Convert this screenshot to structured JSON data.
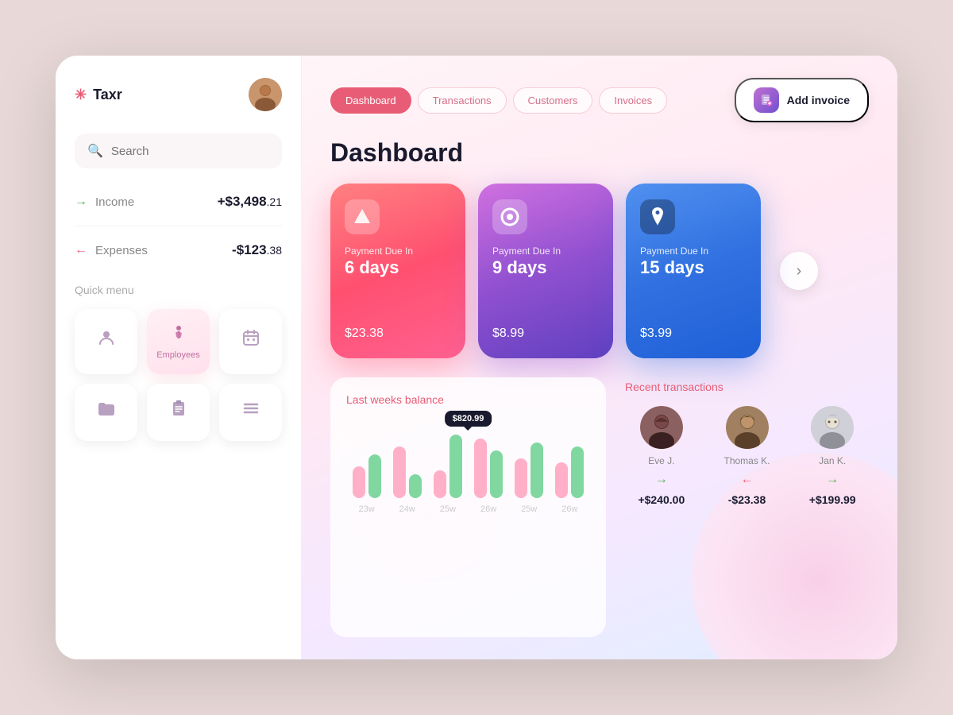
{
  "app": {
    "name": "Taxr",
    "logo_icon": "✳"
  },
  "nav": {
    "tabs": [
      {
        "id": "dashboard",
        "label": "Dashboard",
        "active": true
      },
      {
        "id": "transactions",
        "label": "Transactions",
        "active": false
      },
      {
        "id": "customers",
        "label": "Customers",
        "active": false
      },
      {
        "id": "invoices",
        "label": "Invoices",
        "active": false
      }
    ],
    "add_invoice_label": "Add invoice"
  },
  "sidebar": {
    "search_placeholder": "Search",
    "income": {
      "label": "Income",
      "value": "+$3,498",
      "cents": ".21"
    },
    "expenses": {
      "label": "Expenses",
      "value": "-$123",
      "cents": ".38"
    },
    "quick_menu": {
      "label": "Quick menu",
      "items": [
        {
          "id": "contacts",
          "icon": "👤",
          "label": "",
          "active": false
        },
        {
          "id": "employees",
          "icon": "🧍",
          "label": "Employees",
          "active": true
        },
        {
          "id": "calendar",
          "icon": "📅",
          "label": "",
          "active": false
        },
        {
          "id": "folder",
          "icon": "📁",
          "label": "",
          "active": false
        },
        {
          "id": "clipboard",
          "icon": "📋",
          "label": "",
          "active": false
        },
        {
          "id": "menu",
          "icon": "≡",
          "label": "",
          "active": false
        }
      ]
    }
  },
  "page_title": "Dashboard",
  "payment_cards": [
    {
      "id": "card1",
      "gradient": "red",
      "logo": "▲",
      "due_label": "Payment Due In",
      "due_days": "6 days",
      "amount": "$23",
      "cents": ".38"
    },
    {
      "id": "card2",
      "gradient": "purple",
      "logo": "⊙",
      "due_label": "Payment Due In",
      "due_days": "9 days",
      "amount": "$8",
      "cents": ".99"
    },
    {
      "id": "card3",
      "gradient": "blue",
      "logo": "",
      "due_label": "Payment Due In",
      "due_days": "15 days",
      "amount": "$3",
      "cents": ".99"
    }
  ],
  "balance": {
    "title": "Last weeks balance",
    "tooltip": "$820.99",
    "weeks": [
      "23w",
      "24w",
      "25w",
      "26w",
      "25w",
      "26w"
    ],
    "bars": [
      {
        "pink": 40,
        "green": 55
      },
      {
        "pink": 65,
        "green": 30
      },
      {
        "pink": 35,
        "green": 80
      },
      {
        "pink": 75,
        "green": 60
      },
      {
        "pink": 50,
        "green": 70
      },
      {
        "pink": 45,
        "green": 65
      }
    ]
  },
  "transactions": {
    "title": "Recent transactions",
    "items": [
      {
        "name": "Eve J.",
        "direction": "in",
        "arrow": "→",
        "amount": "+$240",
        "cents": ".00"
      },
      {
        "name": "Thomas K.",
        "direction": "out",
        "arrow": "←",
        "amount": "-$23",
        "cents": ".38"
      },
      {
        "name": "Jan K.",
        "direction": "in",
        "arrow": "→",
        "amount": "+$199",
        "cents": ".99"
      }
    ]
  }
}
